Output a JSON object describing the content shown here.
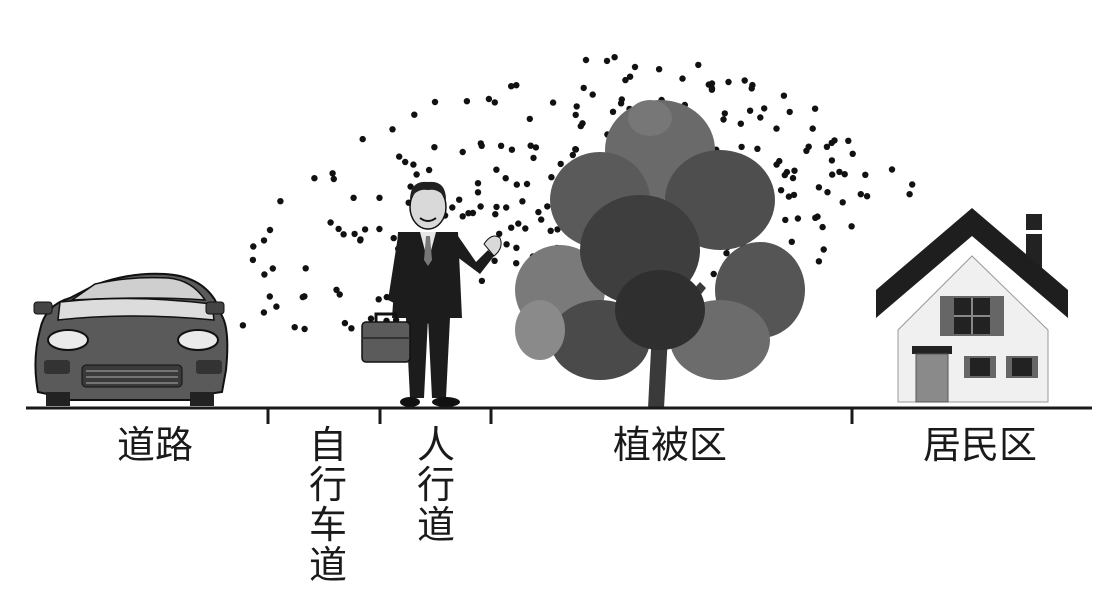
{
  "zones": {
    "road": "道路",
    "bike_lane": [
      "自",
      "行",
      "车",
      "道"
    ],
    "sidewalk": [
      "人",
      "行",
      "道"
    ],
    "vegetation": "植被区",
    "residential": "居民区"
  },
  "colors": {
    "ground": "#1a1a1a",
    "particles": "#111111",
    "car_body": "#5a5a5a",
    "suit": "#1c1c1c",
    "tree_foliage": "#555555",
    "roof": "#222222"
  },
  "icons": [
    "car-icon",
    "businessman-icon",
    "tree-icon",
    "house-icon"
  ]
}
